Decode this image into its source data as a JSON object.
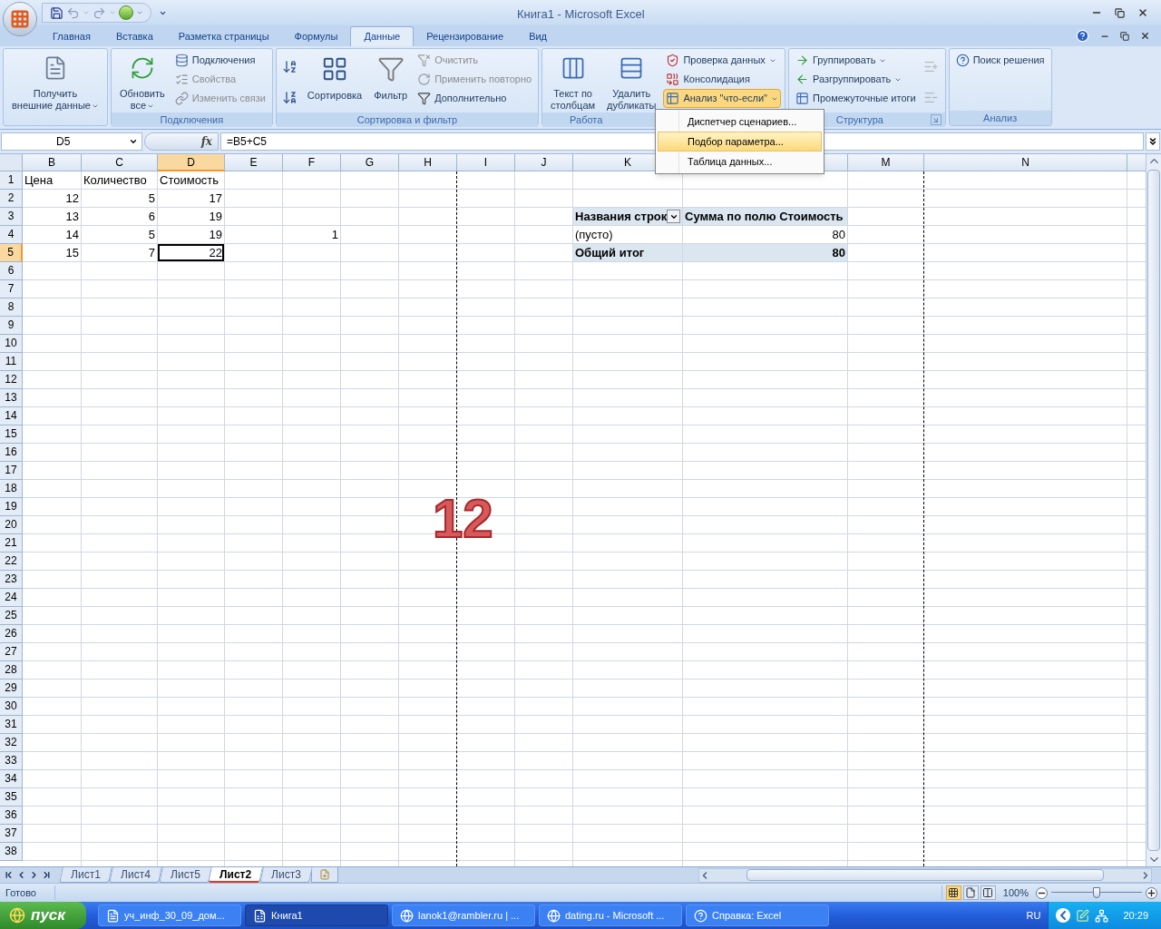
{
  "window": {
    "title": "Книга1 - Microsoft Excel"
  },
  "tabs": [
    {
      "label": "Главная",
      "selected": false
    },
    {
      "label": "Вставка",
      "selected": false
    },
    {
      "label": "Разметка страницы",
      "selected": false
    },
    {
      "label": "Формулы",
      "selected": false
    },
    {
      "label": "Данные",
      "selected": true
    },
    {
      "label": "Рецензирование",
      "selected": false
    },
    {
      "label": "Вид",
      "selected": false
    }
  ],
  "ribbon": {
    "groups": [
      {
        "items": [
          {
            "label": "Получить\nвнешние данные",
            "kind": "large",
            "dropdown": true,
            "disabled": false,
            "active": false
          }
        ]
      },
      {
        "label": "Подключения",
        "launcher": false,
        "items": [
          {
            "label": "Обновить\nвсе",
            "kind": "large",
            "dropdown": true,
            "disabled": false,
            "active": false
          },
          {
            "label": "Подключения",
            "kind": "small",
            "dropdown": false,
            "disabled": false,
            "active": false
          },
          {
            "label": "Свойства",
            "kind": "small",
            "dropdown": false,
            "disabled": true,
            "active": false
          },
          {
            "label": "Изменить связи",
            "kind": "small",
            "dropdown": false,
            "disabled": true,
            "active": false
          }
        ]
      },
      {
        "label": "Сортировка и фильтр",
        "launcher": false,
        "items": [
          {
            "kind": "icon_small",
            "dropdown": false,
            "disabled": false,
            "active": false
          },
          {
            "kind": "icon_small",
            "dropdown": false,
            "disabled": false,
            "active": false
          },
          {
            "label": "Сортировка",
            "kind": "large",
            "dropdown": false,
            "disabled": false,
            "active": false
          },
          {
            "label": "Фильтр",
            "kind": "large",
            "dropdown": false,
            "disabled": false,
            "active": false
          },
          {
            "label": "Очистить",
            "kind": "small",
            "dropdown": false,
            "disabled": true,
            "active": false
          },
          {
            "label": "Применить повторно",
            "kind": "small",
            "dropdown": false,
            "disabled": true,
            "active": false
          },
          {
            "label": "Дополнительно",
            "kind": "small",
            "dropdown": false,
            "disabled": false,
            "active": false
          }
        ]
      },
      {
        "label": "Работа",
        "launcher": false,
        "items": [
          {
            "label": "Текст по\nстолбцам",
            "kind": "large",
            "dropdown": false,
            "disabled": false,
            "active": false
          },
          {
            "label": "Удалить\nдубликаты",
            "kind": "large",
            "dropdown": false,
            "disabled": false,
            "active": false
          },
          {
            "label": "Проверка данных",
            "kind": "small",
            "dropdown": true,
            "disabled": false,
            "active": false
          },
          {
            "label": "Консолидация",
            "kind": "small",
            "dropdown": false,
            "disabled": false,
            "active": false
          },
          {
            "label": "Анализ \"что-если\"",
            "kind": "small",
            "dropdown": true,
            "disabled": false,
            "active": true
          }
        ]
      },
      {
        "label": "Структура",
        "launcher": true,
        "items": [
          {
            "label": "Группировать",
            "kind": "small",
            "dropdown": true,
            "disabled": false,
            "active": false
          },
          {
            "label": "Разгруппировать",
            "kind": "small",
            "dropdown": true,
            "disabled": false,
            "active": false
          },
          {
            "label": "Промежуточные итоги",
            "kind": "small",
            "dropdown": false,
            "disabled": false,
            "active": false
          },
          {
            "kind": "icon_small",
            "dropdown": false,
            "disabled": true,
            "active": false
          },
          {
            "kind": "icon_small",
            "dropdown": false,
            "disabled": true,
            "active": false
          }
        ]
      },
      {
        "label": "Анализ",
        "launcher": false,
        "items": [
          {
            "label": "Поиск решения",
            "kind": "small",
            "dropdown": false,
            "disabled": false,
            "active": false
          }
        ]
      }
    ]
  },
  "what_if_menu": {
    "items": [
      {
        "label": "Диспетчер сценариев...",
        "selected": false
      },
      {
        "label": "Подбор параметра...",
        "selected": true
      },
      {
        "label": "Таблица данных...",
        "selected": false
      }
    ]
  },
  "formula_bar": {
    "name_box": "D5",
    "function_label": "fx",
    "formula": "=B5+C5"
  },
  "sheet": {
    "overlay_number": "12",
    "columns": [
      {
        "letter": "B",
        "selected": false,
        "page_break": false
      },
      {
        "letter": "C",
        "selected": false,
        "page_break": false
      },
      {
        "letter": "D",
        "selected": true,
        "page_break": false
      },
      {
        "letter": "E",
        "selected": false,
        "page_break": false
      },
      {
        "letter": "F",
        "selected": false,
        "page_break": false
      },
      {
        "letter": "G",
        "selected": false,
        "page_break": false
      },
      {
        "letter": "H",
        "selected": false,
        "page_break": true
      },
      {
        "letter": "I",
        "selected": false,
        "page_break": false
      },
      {
        "letter": "J",
        "selected": false,
        "page_break": false
      },
      {
        "letter": "K",
        "selected": false,
        "page_break": false
      },
      {
        "selected": false,
        "page_break": false
      },
      {
        "letter": "M",
        "selected": false,
        "page_break": true
      },
      {
        "letter": "N",
        "selected": false,
        "page_break": false
      }
    ],
    "rows": [
      {
        "label": "1",
        "selected": false,
        "cells": [
          {
            "text": "Цена",
            "kind": "text",
            "bold": false,
            "shaded": false
          },
          {
            "text": "Количество",
            "kind": "text",
            "bold": false,
            "shaded": false
          },
          {
            "text": "Стоимость",
            "kind": "text",
            "bold": false,
            "shaded": false
          }
        ]
      },
      {
        "label": "2",
        "selected": false,
        "cells": [
          {
            "text": "12",
            "kind": "number",
            "bold": false,
            "shaded": false
          },
          {
            "text": "5",
            "kind": "number",
            "bold": false,
            "shaded": false
          },
          {
            "text": "17",
            "kind": "number",
            "bold": false,
            "shaded": false
          }
        ]
      },
      {
        "label": "3",
        "selected": false,
        "cells": [
          {
            "text": "13",
            "kind": "number",
            "bold": false,
            "shaded": false
          },
          {
            "text": "6",
            "kind": "number",
            "bold": false,
            "shaded": false
          },
          {
            "text": "19",
            "kind": "number",
            "bold": false,
            "shaded": false
          },
          null,
          null,
          null,
          null,
          null,
          null,
          {
            "text": "Названия строк",
            "kind": "filter_header",
            "bold": true,
            "shaded": true
          },
          {
            "text": "Сумма по полю Стоимость",
            "kind": "text",
            "bold": true,
            "shaded": true
          }
        ]
      },
      {
        "label": "4",
        "selected": false,
        "cells": [
          {
            "text": "14",
            "kind": "number",
            "bold": false,
            "shaded": false
          },
          {
            "text": "5",
            "kind": "number",
            "bold": false,
            "shaded": false
          },
          {
            "text": "19",
            "kind": "number",
            "bold": false,
            "shaded": false
          },
          null,
          {
            "text": "1",
            "kind": "number",
            "bold": false,
            "shaded": false
          },
          null,
          null,
          null,
          null,
          {
            "text": "(пусто)",
            "kind": "text",
            "bold": false,
            "shaded": false
          },
          {
            "text": "80",
            "kind": "number",
            "bold": false,
            "shaded": false
          }
        ]
      },
      {
        "label": "5",
        "selected": true,
        "cells": [
          {
            "text": "15",
            "kind": "number",
            "bold": false,
            "shaded": false
          },
          {
            "text": "7",
            "kind": "number",
            "bold": false,
            "shaded": false
          },
          {
            "text": "22",
            "kind": "number",
            "bold": false,
            "shaded": false
          },
          null,
          null,
          null,
          null,
          null,
          null,
          {
            "text": "Общий итог",
            "kind": "text",
            "bold": true,
            "shaded": true
          },
          {
            "text": "80",
            "kind": "number",
            "bold": true,
            "shaded": true
          }
        ]
      },
      {
        "label": "6",
        "selected": false
      },
      {
        "label": "7",
        "selected": false
      },
      {
        "label": "8",
        "selected": false
      },
      {
        "label": "9",
        "selected": false
      },
      {
        "label": "10",
        "selected": false
      },
      {
        "label": "11",
        "selected": false
      },
      {
        "label": "12",
        "selected": false
      },
      {
        "label": "13",
        "selected": false
      },
      {
        "label": "14",
        "selected": false
      },
      {
        "label": "15",
        "selected": false
      },
      {
        "label": "16",
        "selected": false
      },
      {
        "label": "17",
        "selected": false
      },
      {
        "label": "18",
        "selected": false
      },
      {
        "label": "19",
        "selected": false
      },
      {
        "label": "20",
        "selected": false
      },
      {
        "label": "21",
        "selected": false
      },
      {
        "label": "22",
        "selected": false
      },
      {
        "label": "23",
        "selected": false
      },
      {
        "label": "24",
        "selected": false
      },
      {
        "label": "25",
        "selected": false
      },
      {
        "label": "26",
        "selected": false
      },
      {
        "label": "27",
        "selected": false
      },
      {
        "label": "28",
        "selected": false
      },
      {
        "label": "29",
        "selected": false
      },
      {
        "label": "30",
        "selected": false
      },
      {
        "label": "31",
        "selected": false
      },
      {
        "label": "32",
        "selected": false
      },
      {
        "label": "33",
        "selected": false
      },
      {
        "label": "34",
        "selected": false
      },
      {
        "label": "35",
        "selected": false
      },
      {
        "label": "36",
        "selected": false
      },
      {
        "label": "37",
        "selected": false
      },
      {
        "label": "38",
        "selected": false
      }
    ]
  },
  "sheet_tabs": [
    {
      "label": "Лист1",
      "selected": false
    },
    {
      "label": "Лист4",
      "selected": false
    },
    {
      "label": "Лист5",
      "selected": false
    },
    {
      "label": "Лист2",
      "selected": true
    },
    {
      "label": "Лист3",
      "selected": false
    }
  ],
  "status_bar": {
    "status": "Готово",
    "views": [
      {
        "selected": true
      },
      {
        "selected": false
      },
      {
        "selected": false
      }
    ],
    "zoom": "100%",
    "zoom_slider": {
      "level": 0.5
    }
  },
  "taskbar": {
    "start": "пуск",
    "items": [
      {
        "label": "уч_инф_30_09_дом...",
        "selected": false
      },
      {
        "label": "Книга1",
        "selected": true
      },
      {
        "label": "lanok1@rambler.ru | ...",
        "selected": false
      },
      {
        "label": "dating.ru - Microsoft ...",
        "selected": false
      },
      {
        "label": "Справка: Excel",
        "selected": false
      }
    ],
    "language": "RU",
    "clock": "20:29"
  }
}
